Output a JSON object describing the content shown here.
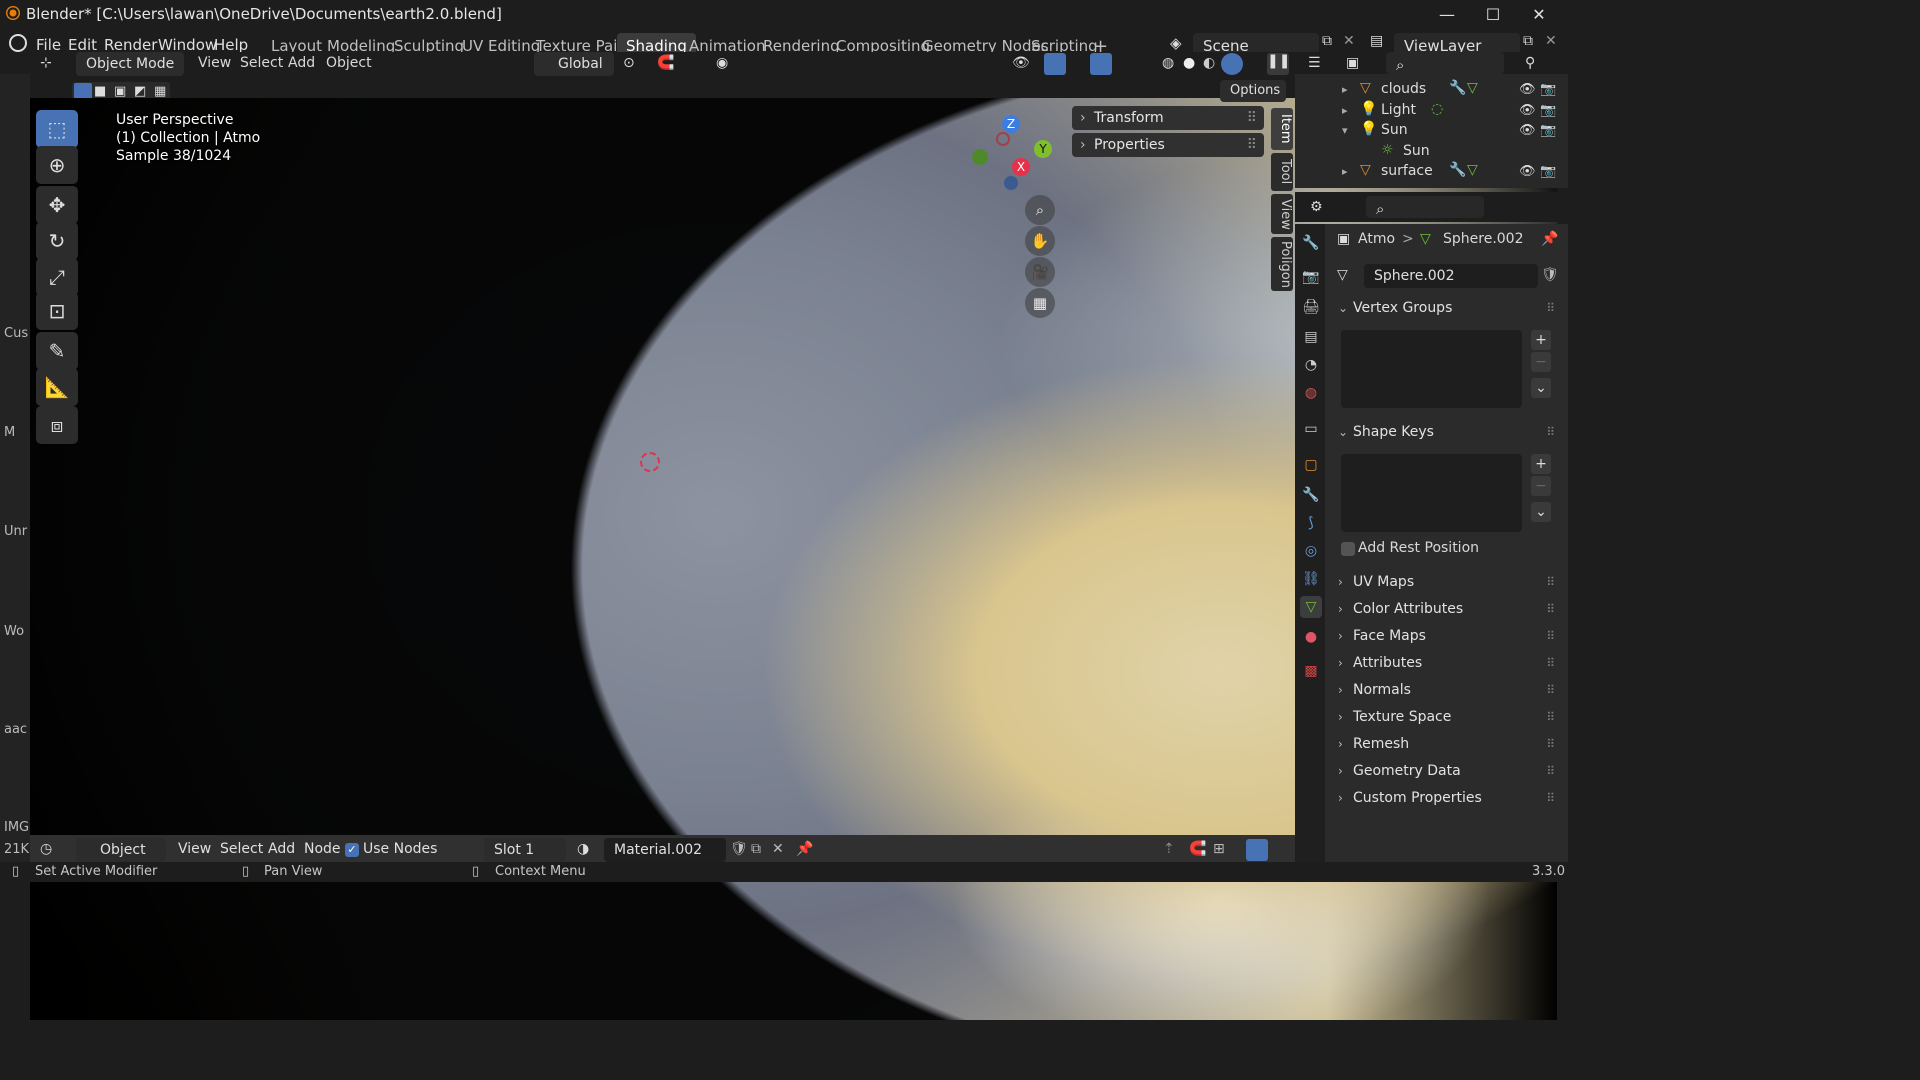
{
  "window": {
    "title": "Blender* [C:\\Users\\lawan\\OneDrive\\Documents\\earth2.0.blend]",
    "controls": [
      "—",
      "☐",
      "✕"
    ]
  },
  "menus": [
    "File",
    "Edit",
    "Render",
    "Window",
    "Help"
  ],
  "workspaces": [
    "Layout",
    "Modeling",
    "Sculpting",
    "UV Editing",
    "Texture Paint",
    "Shading",
    "Animation",
    "Rendering",
    "Compositing",
    "Geometry Nodes",
    "Scripting"
  ],
  "active_workspace": "Shading",
  "add_workspace": "+",
  "scene": "Scene",
  "view_layer": "ViewLayer",
  "header": {
    "mode": "Object Mode",
    "menus": [
      "View",
      "Select",
      "Add",
      "Object"
    ],
    "orientation": "Global"
  },
  "viewport": {
    "options": "Options",
    "info_lines": [
      "User Perspective",
      "(1) Collection | Atmo",
      "Sample 38/1024"
    ],
    "npanels": [
      "Transform",
      "Properties"
    ],
    "side_tabs": [
      "Item",
      "Tool",
      "View",
      "Poligon"
    ],
    "gizmo": {
      "z": "Z",
      "y": "Y",
      "x": "X"
    }
  },
  "outliner": {
    "items": [
      {
        "label": "clouds",
        "icon": "mesh-object-icon",
        "expanded": false
      },
      {
        "label": "Light",
        "icon": "light-object-icon",
        "expanded": false
      },
      {
        "label": "Sun",
        "icon": "light-object-icon",
        "expanded": true
      },
      {
        "label": "Sun",
        "icon": "sun-data-icon",
        "expanded": false
      },
      {
        "label": "surface",
        "icon": "mesh-object-icon",
        "expanded": false
      }
    ]
  },
  "properties": {
    "breadcrumb_object": "Atmo",
    "breadcrumb_sep": ">",
    "breadcrumb_data": "Sphere.002",
    "data_name": "Sphere.002",
    "sections_open": [
      "Vertex Groups",
      "Shape Keys"
    ],
    "add_rest_position": "Add Rest Position",
    "sections_closed": [
      "UV Maps",
      "Color Attributes",
      "Face Maps",
      "Attributes",
      "Normals",
      "Texture Space",
      "Remesh",
      "Geometry Data",
      "Custom Properties"
    ]
  },
  "bottom": {
    "editor": "Object",
    "menus": [
      "View",
      "Select",
      "Add",
      "Node"
    ],
    "use_nodes": "Use Nodes",
    "slot": "Slot 1",
    "material": "Material.002"
  },
  "statusbar": {
    "items": [
      "Set Active Modifier",
      "Pan View",
      "Context Menu"
    ],
    "version": "3.3.0"
  },
  "left_strip": [
    "Cus",
    "M",
    "Unr",
    "Wo",
    "aac",
    "IMG",
    "21K"
  ],
  "colors": {
    "accent_blue": "#4772b3",
    "object_orange": "#e88b2e",
    "data_green": "#6fbf3b",
    "gizmo_x": "#e8304a",
    "gizmo_y": "#7fbf2b",
    "gizmo_z": "#3b7de0"
  }
}
